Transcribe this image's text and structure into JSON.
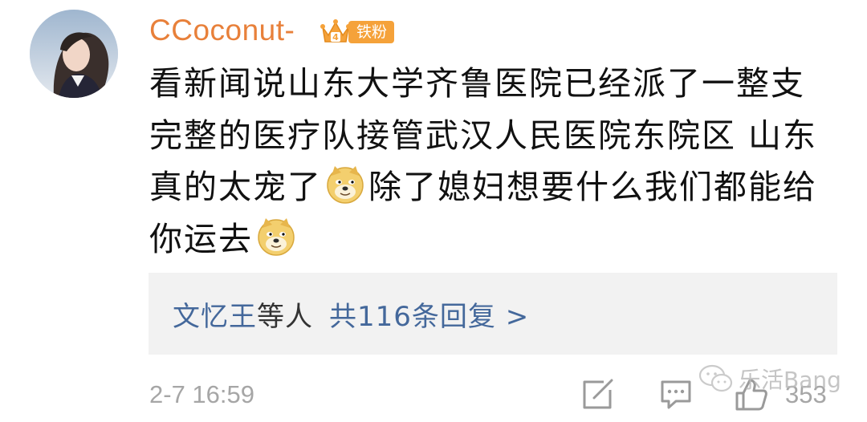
{
  "comment": {
    "username": "CCoconut-",
    "badge": {
      "label": "铁粉",
      "icon": "crown-icon",
      "color": "#f5a23a"
    },
    "text_parts": {
      "p1": "看新闻说山东大学齐鲁医院已经派了一整支完整的医疗队接管武汉人民医院东院区 山东真的太宠了",
      "emoji1": "doge-emoji",
      "p2": "除了媳妇想要什么我们都能给你运去",
      "emoji2": "doge-emoji"
    },
    "replies": {
      "names": "文忆王",
      "names_suffix": "等人",
      "count_text": "共116条回复 >"
    },
    "timestamp": "2-7 16:59",
    "actions": {
      "share_icon": "share-icon",
      "reply_icon": "comment-icon",
      "like_icon": "thumbs-up-icon",
      "like_count": "353"
    },
    "watermark": "乐活Bang"
  },
  "colors": {
    "username": "#e8803a",
    "link": "#44689b",
    "meta": "#a6a6a6",
    "reply_bg": "#f2f2f2"
  }
}
